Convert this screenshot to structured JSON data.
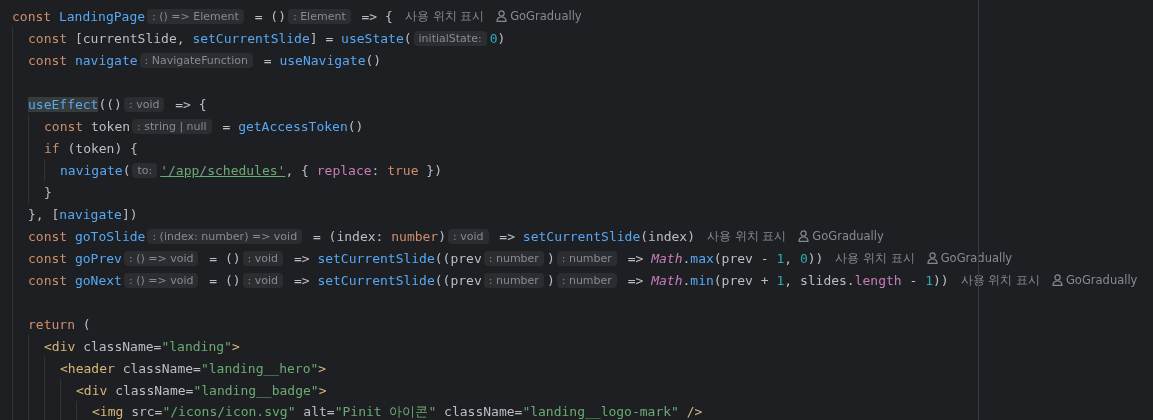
{
  "editor": {
    "lines": [
      {
        "kind": "code",
        "tokens": [
          {
            "kind": "kw",
            "text": "const "
          },
          {
            "kind": "fn",
            "text": "LandingPage"
          },
          {
            "kind": "hint",
            "text": ": () => Element"
          },
          {
            "kind": "plain",
            "text": " = ()"
          },
          {
            "kind": "hint",
            "text": ": Element"
          },
          {
            "kind": "plain",
            "text": " => {"
          },
          {
            "kind": "usage",
            "text": "사용 위치 표시"
          },
          {
            "kind": "author",
            "text": "GoGradually"
          }
        ],
        "children": [
          {
            "kind": "code",
            "tokens": [
              {
                "kind": "kw",
                "text": "const "
              },
              {
                "kind": "plain",
                "text": "[currentSlide, "
              },
              {
                "kind": "fn",
                "text": "setCurrentSlide"
              },
              {
                "kind": "plain",
                "text": "] = "
              },
              {
                "kind": "fn",
                "text": "useState"
              },
              {
                "kind": "plain",
                "text": "("
              },
              {
                "kind": "hint",
                "text": "initialState:"
              },
              {
                "kind": "num",
                "text": "0"
              },
              {
                "kind": "plain",
                "text": ")"
              }
            ]
          },
          {
            "kind": "code",
            "tokens": [
              {
                "kind": "kw",
                "text": "const "
              },
              {
                "kind": "fn",
                "text": "navigate"
              },
              {
                "kind": "hint",
                "text": ": NavigateFunction"
              },
              {
                "kind": "plain",
                "text": " = "
              },
              {
                "kind": "fn",
                "text": "useNavigate"
              },
              {
                "kind": "plain",
                "text": "()"
              }
            ]
          },
          {
            "kind": "blank"
          },
          {
            "kind": "code",
            "tokens": [
              {
                "kind": "fn",
                "text": "useEffect",
                "highlighted": true
              },
              {
                "kind": "plain",
                "text": "(()"
              },
              {
                "kind": "hint",
                "text": ": void"
              },
              {
                "kind": "plain",
                "text": " => {"
              }
            ],
            "children": [
              {
                "kind": "code",
                "tokens": [
                  {
                    "kind": "kw",
                    "text": "const "
                  },
                  {
                    "kind": "plain",
                    "text": "token"
                  },
                  {
                    "kind": "hint",
                    "text": ": string | null"
                  },
                  {
                    "kind": "plain",
                    "text": " = "
                  },
                  {
                    "kind": "fn",
                    "text": "getAccessToken"
                  },
                  {
                    "kind": "plain",
                    "text": "()"
                  }
                ]
              },
              {
                "kind": "code",
                "tokens": [
                  {
                    "kind": "kw",
                    "text": "if "
                  },
                  {
                    "kind": "plain",
                    "text": "(token) {"
                  }
                ],
                "children": [
                  {
                    "kind": "code",
                    "tokens": [
                      {
                        "kind": "fn",
                        "text": "navigate"
                      },
                      {
                        "kind": "plain",
                        "text": "("
                      },
                      {
                        "kind": "hint",
                        "text": "to:"
                      },
                      {
                        "kind": "link",
                        "text": "'/app/schedules'"
                      },
                      {
                        "kind": "plain",
                        "text": ", { "
                      },
                      {
                        "kind": "prop",
                        "text": "replace"
                      },
                      {
                        "kind": "plain",
                        "text": ": "
                      },
                      {
                        "kind": "kw",
                        "text": "true"
                      },
                      {
                        "kind": "plain",
                        "text": " })"
                      }
                    ]
                  }
                ]
              },
              {
                "kind": "code",
                "tokens": [
                  {
                    "kind": "plain",
                    "text": "}"
                  }
                ]
              }
            ]
          },
          {
            "kind": "code",
            "tokens": [
              {
                "kind": "plain",
                "text": "}, ["
              },
              {
                "kind": "fn",
                "text": "navigate"
              },
              {
                "kind": "plain",
                "text": "])"
              }
            ]
          },
          {
            "kind": "code",
            "tokens": [
              {
                "kind": "kw",
                "text": "const "
              },
              {
                "kind": "fn",
                "text": "goToSlide"
              },
              {
                "kind": "hint",
                "text": ": (index: number) => void"
              },
              {
                "kind": "plain",
                "text": " = (index: "
              },
              {
                "kind": "kw",
                "text": "number"
              },
              {
                "kind": "plain",
                "text": ")"
              },
              {
                "kind": "hint",
                "text": ": void"
              },
              {
                "kind": "plain",
                "text": " => "
              },
              {
                "kind": "fn",
                "text": "setCurrentSlide"
              },
              {
                "kind": "plain",
                "text": "(index)"
              },
              {
                "kind": "usage",
                "text": "사용 위치 표시"
              },
              {
                "kind": "author",
                "text": "GoGradually"
              }
            ]
          },
          {
            "kind": "code",
            "tokens": [
              {
                "kind": "kw",
                "text": "const "
              },
              {
                "kind": "fn",
                "text": "goPrev"
              },
              {
                "kind": "hint",
                "text": ": () => void"
              },
              {
                "kind": "plain",
                "text": " = ()"
              },
              {
                "kind": "hint",
                "text": ": void"
              },
              {
                "kind": "plain",
                "text": " => "
              },
              {
                "kind": "fn",
                "text": "setCurrentSlide"
              },
              {
                "kind": "plain",
                "text": "((prev"
              },
              {
                "kind": "hint",
                "text": ": number"
              },
              {
                "kind": "plain",
                "text": ")"
              },
              {
                "kind": "hint",
                "text": ": number"
              },
              {
                "kind": "plain",
                "text": " => "
              },
              {
                "kind": "math",
                "text": "Math"
              },
              {
                "kind": "plain",
                "text": "."
              },
              {
                "kind": "fn",
                "text": "max"
              },
              {
                "kind": "plain",
                "text": "(prev - "
              },
              {
                "kind": "num",
                "text": "1"
              },
              {
                "kind": "plain",
                "text": ", "
              },
              {
                "kind": "num",
                "text": "0"
              },
              {
                "kind": "plain",
                "text": "))"
              },
              {
                "kind": "usage",
                "text": "사용 위치 표시"
              },
              {
                "kind": "author",
                "text": "GoGradually"
              }
            ]
          },
          {
            "kind": "code",
            "tokens": [
              {
                "kind": "kw",
                "text": "const "
              },
              {
                "kind": "fn",
                "text": "goNext"
              },
              {
                "kind": "hint",
                "text": ": () => void"
              },
              {
                "kind": "plain",
                "text": " = ()"
              },
              {
                "kind": "hint",
                "text": ": void"
              },
              {
                "kind": "plain",
                "text": " => "
              },
              {
                "kind": "fn",
                "text": "setCurrentSlide"
              },
              {
                "kind": "plain",
                "text": "((prev"
              },
              {
                "kind": "hint",
                "text": ": number"
              },
              {
                "kind": "plain",
                "text": ")"
              },
              {
                "kind": "hint",
                "text": ": number"
              },
              {
                "kind": "plain",
                "text": " => "
              },
              {
                "kind": "math",
                "text": "Math"
              },
              {
                "kind": "plain",
                "text": "."
              },
              {
                "kind": "fn",
                "text": "min"
              },
              {
                "kind": "plain",
                "text": "(prev + "
              },
              {
                "kind": "num",
                "text": "1"
              },
              {
                "kind": "plain",
                "text": ", slides."
              },
              {
                "kind": "prop",
                "text": "length"
              },
              {
                "kind": "plain",
                "text": " - "
              },
              {
                "kind": "num",
                "text": "1"
              },
              {
                "kind": "plain",
                "text": "))"
              },
              {
                "kind": "usage",
                "text": "사용 위치 표시"
              },
              {
                "kind": "author",
                "text": "GoGradually"
              }
            ]
          },
          {
            "kind": "blank"
          },
          {
            "kind": "code",
            "tokens": [
              {
                "kind": "kw",
                "text": "return "
              },
              {
                "kind": "plain",
                "text": "("
              }
            ],
            "children": [
              {
                "kind": "code",
                "tokens": [
                  {
                    "kind": "tag",
                    "text": "<div "
                  },
                  {
                    "kind": "plain",
                    "text": "className="
                  },
                  {
                    "kind": "str",
                    "text": "\"landing\""
                  },
                  {
                    "kind": "tag",
                    "text": ">"
                  }
                ],
                "children": [
                  {
                    "kind": "code",
                    "tokens": [
                      {
                        "kind": "tag",
                        "text": "<header "
                      },
                      {
                        "kind": "plain",
                        "text": "className="
                      },
                      {
                        "kind": "str",
                        "text": "\"landing__hero\""
                      },
                      {
                        "kind": "tag",
                        "text": ">"
                      }
                    ],
                    "children": [
                      {
                        "kind": "code",
                        "tokens": [
                          {
                            "kind": "tag",
                            "text": "<div "
                          },
                          {
                            "kind": "plain",
                            "text": "className="
                          },
                          {
                            "kind": "str",
                            "text": "\"landing__badge\""
                          },
                          {
                            "kind": "tag",
                            "text": ">"
                          }
                        ],
                        "children": [
                          {
                            "kind": "code",
                            "tokens": [
                              {
                                "kind": "tag",
                                "text": "<img "
                              },
                              {
                                "kind": "plain",
                                "text": "src="
                              },
                              {
                                "kind": "str",
                                "text": "\"/icons/icon.svg\""
                              },
                              {
                                "kind": "plain",
                                "text": " alt="
                              },
                              {
                                "kind": "str",
                                "text": "\"Pinit 아이콘\""
                              },
                              {
                                "kind": "plain",
                                "text": " className="
                              },
                              {
                                "kind": "str",
                                "text": "\"landing__logo-mark\""
                              },
                              {
                                "kind": "tag",
                                "text": " />"
                              }
                            ]
                          }
                        ]
                      }
                    ]
                  }
                ]
              }
            ]
          }
        ]
      }
    ]
  }
}
